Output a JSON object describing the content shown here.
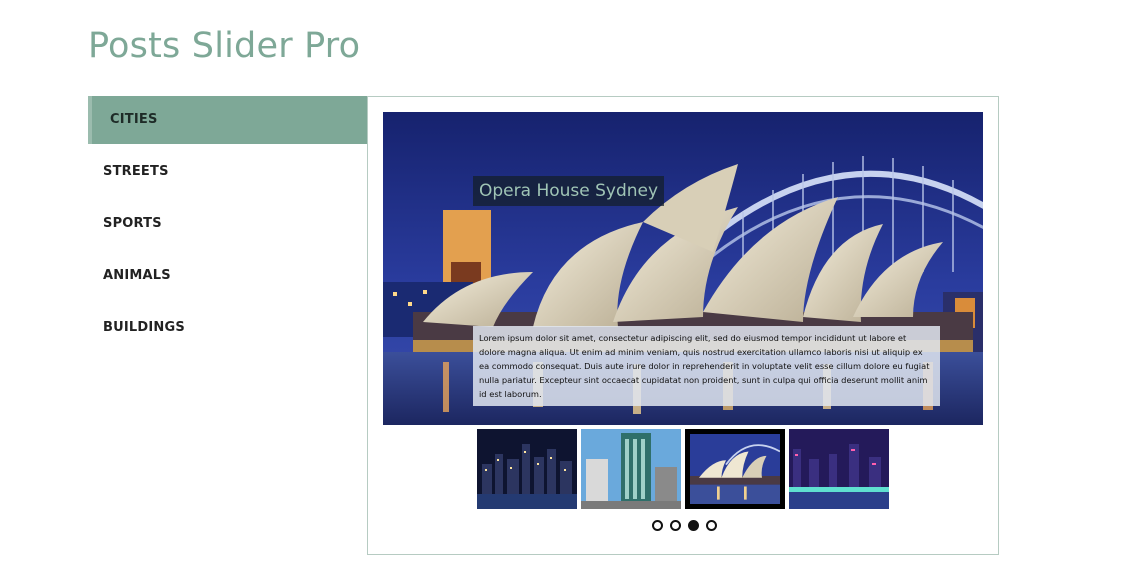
{
  "page": {
    "title": "Posts Slider Pro"
  },
  "tabs": [
    {
      "label": "CITIES",
      "active": true
    },
    {
      "label": "STREETS",
      "active": false
    },
    {
      "label": "SPORTS",
      "active": false
    },
    {
      "label": "ANIMALS",
      "active": false
    },
    {
      "label": "BUILDINGS",
      "active": false
    }
  ],
  "slider": {
    "current_slide": {
      "title": "Opera House Sydney",
      "excerpt": "Lorem ipsum dolor sit amet, consectetur adipiscing elit, sed do eiusmod tempor incididunt ut labore et dolore magna aliqua. Ut enim ad minim veniam, quis nostrud exercitation ullamco laboris nisi ut aliquip ex ea commodo consequat. Duis aute irure dolor in reprehenderit in voluptate velit esse cillum dolore eu fugiat nulla pariatur. Excepteur sint occaecat cupidatat non proident, sunt in culpa qui officia deserunt mollit anim id est laborum.",
      "image_icon": "opera-house-image"
    },
    "thumbnails": [
      {
        "icon": "city-night-skyline-image",
        "selected": false
      },
      {
        "icon": "office-tower-image",
        "selected": false
      },
      {
        "icon": "opera-house-image",
        "selected": true
      },
      {
        "icon": "city-night-waterfront-image",
        "selected": false
      }
    ],
    "pagination": {
      "count": 4,
      "active_index": 2
    }
  },
  "colors": {
    "accent": "#7ea897",
    "panel_border": "#b6cbc2",
    "caption_title_text": "#9fc4b5"
  }
}
